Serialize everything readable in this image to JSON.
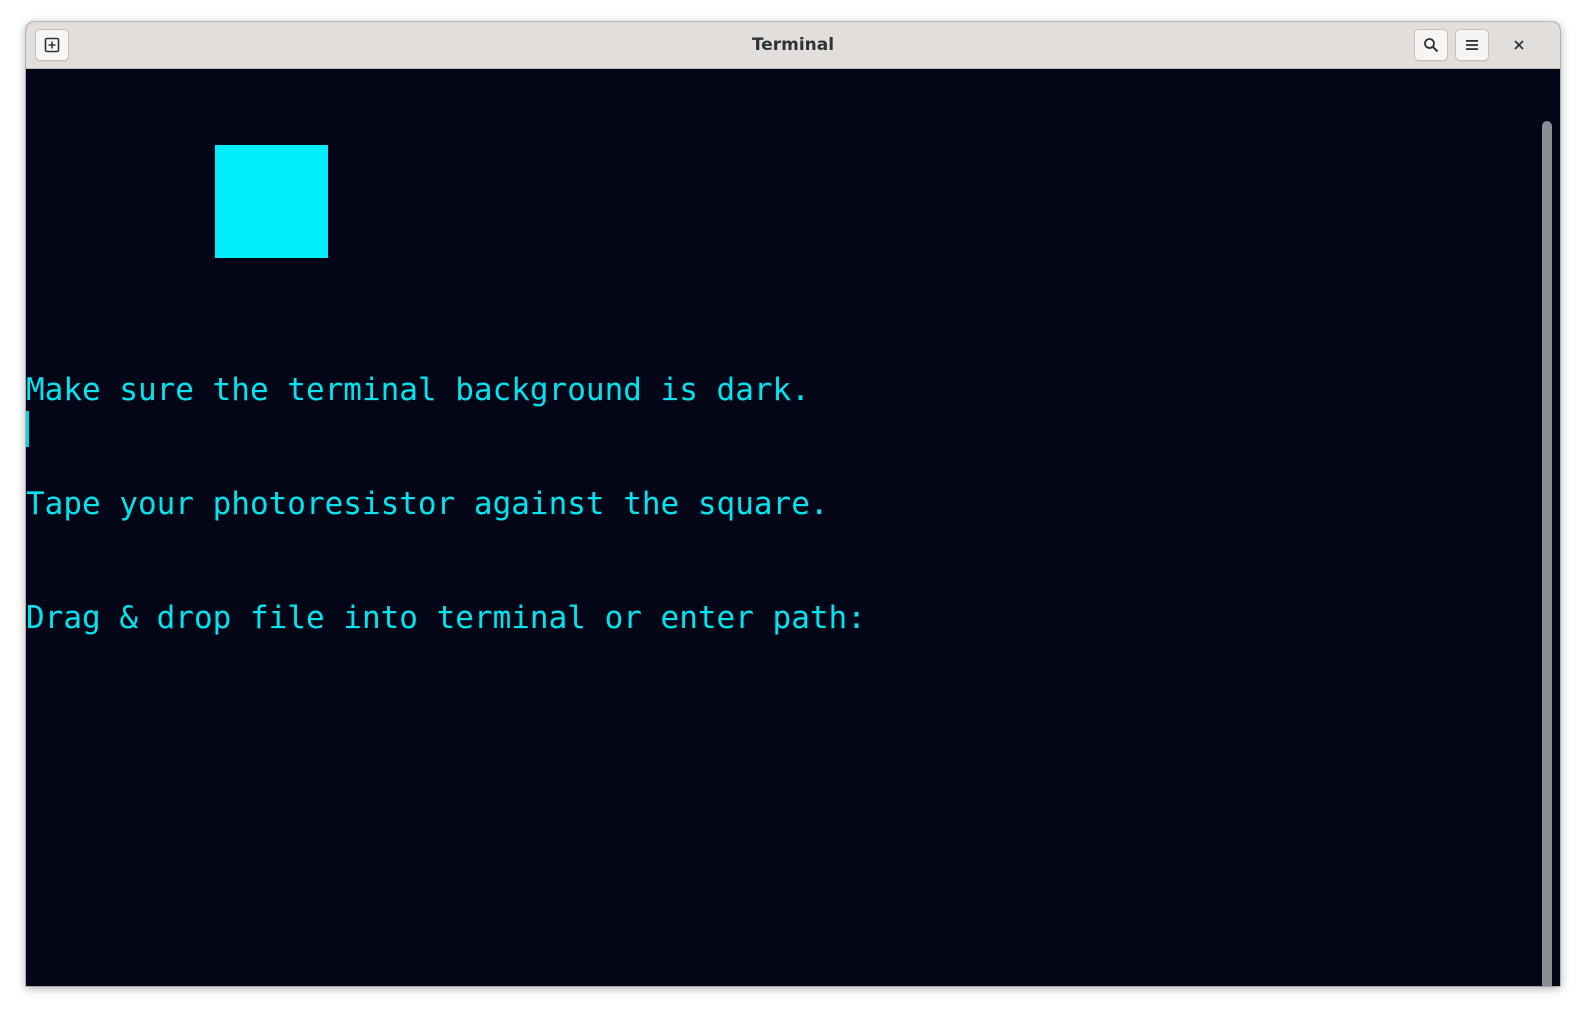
{
  "window": {
    "title": "Terminal"
  },
  "header": {
    "new_tab_icon": "new-tab-icon",
    "search_icon": "search-icon",
    "menu_icon": "hamburger-menu-icon",
    "close_icon": "close-icon"
  },
  "terminal": {
    "background_color": "#030617",
    "text_color": "#00e5f0",
    "square_color": "#00eeff",
    "lines": [
      "Make sure the terminal background is dark.",
      "Tape your photoresistor against the square.",
      "Drag & drop file into terminal or enter path:"
    ],
    "input_value": ""
  }
}
